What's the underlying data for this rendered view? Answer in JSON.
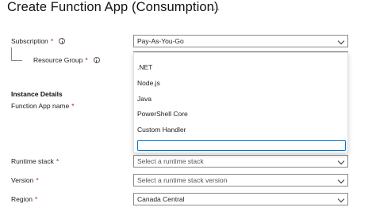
{
  "header": {
    "title": "Create Function App (Consumption)",
    "more_icon": "···"
  },
  "form": {
    "subscription": {
      "label": "Subscription",
      "required_mark": "*",
      "value": "Pay-As-You-Go"
    },
    "resource_group": {
      "label": "Resource Group",
      "required_mark": "*",
      "value": ""
    },
    "instance_details_heading": "Instance Details",
    "function_app_name": {
      "label": "Function App name",
      "required_mark": "*"
    },
    "runtime_stack": {
      "label": "Runtime stack",
      "required_mark": "*",
      "placeholder": "Select a runtime stack"
    },
    "version": {
      "label": "Version",
      "required_mark": "*",
      "placeholder": "Select a runtime stack version"
    },
    "region": {
      "label": "Region",
      "required_mark": "*",
      "value": "Canada Central"
    }
  },
  "runtime_options": {
    "items": [
      ".NET",
      "Node.js",
      "Java",
      "PowerShell Core",
      "Custom Handler"
    ],
    "filter_value": ""
  },
  "colors": {
    "required": "#a4262c",
    "focus_border": "#0078d4",
    "input_border": "#8a8886"
  }
}
